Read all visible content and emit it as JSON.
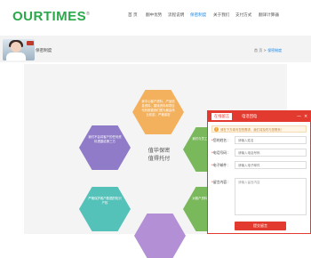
{
  "header": {
    "logo": "OURTIMES",
    "logo_mark": "®",
    "nav": [
      "首 页",
      "翻中优势",
      "流程说明",
      "保密制度",
      "关于我们",
      "支付方式",
      "翻译计算器"
    ],
    "active_nav": "保密制度"
  },
  "page": {
    "section_title": "保密制度",
    "breadcrumb": {
      "home": "首 页",
      "sep": " > ",
      "current": "保密制度"
    }
  },
  "hexagons": {
    "orange": "我中心客户资料、产品信息资料、翻译资料和项目代码都被我们视为最高商业机密，严格保密",
    "purple": "我们不会将客户的任何资料透露给第三方",
    "teal": "严格保护客户数据的知识产权",
    "lilac": "",
    "green1": "我们与员工签订了保密协议",
    "green2": "对客户资料进行严格管理"
  },
  "center_text": "值华保密 值得托付",
  "chat": {
    "tabs": [
      "在线留言",
      "电话回电"
    ],
    "minimize": "—",
    "close": "×",
    "notice": "请在下方填写您的需求，我们将及时与您联系！",
    "fields": [
      {
        "label": "您的姓名：",
        "placeholder": "请输入姓名"
      },
      {
        "label": "电话号码：",
        "placeholder": "请输入电话号码"
      },
      {
        "label": "电子邮件：",
        "placeholder": "请输入电子邮件"
      }
    ],
    "message_label": "留言内容：",
    "message_placeholder": "请输入留言内容",
    "submit": "提交留言"
  }
}
